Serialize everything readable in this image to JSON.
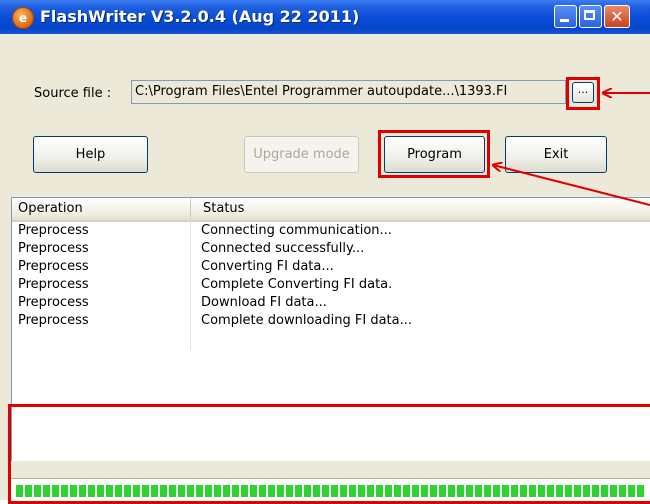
{
  "window": {
    "title": "FlashWriter V3.2.0.4 (Aug 22 2011)",
    "app_icon_glyph": "e",
    "close_glyph": "✕"
  },
  "source": {
    "label": "Source file :",
    "path": "C:\\Program Files\\Entel Programmer autoupdate...\\1393.FI",
    "browse_label": "..."
  },
  "buttons": {
    "help": "Help",
    "upgrade": "Upgrade mode",
    "program": "Program",
    "exit": "Exit"
  },
  "log": {
    "columns": [
      "Operation",
      "Status"
    ],
    "rows": [
      {
        "op": "Preprocess",
        "status": "Connecting communication..."
      },
      {
        "op": "Preprocess",
        "status": "Connected successfully..."
      },
      {
        "op": "Preprocess",
        "status": "Converting FI data..."
      },
      {
        "op": "Preprocess",
        "status": "Complete Converting FI data."
      },
      {
        "op": "Preprocess",
        "status": "Download FI data..."
      },
      {
        "op": "Preprocess",
        "status": "Complete downloading FI data..."
      }
    ]
  },
  "progress": {
    "fraction": 1.0
  },
  "colors": {
    "annotation": "#e00000",
    "progress": "#2fd32f",
    "titlebar": "#0a4bd6"
  }
}
